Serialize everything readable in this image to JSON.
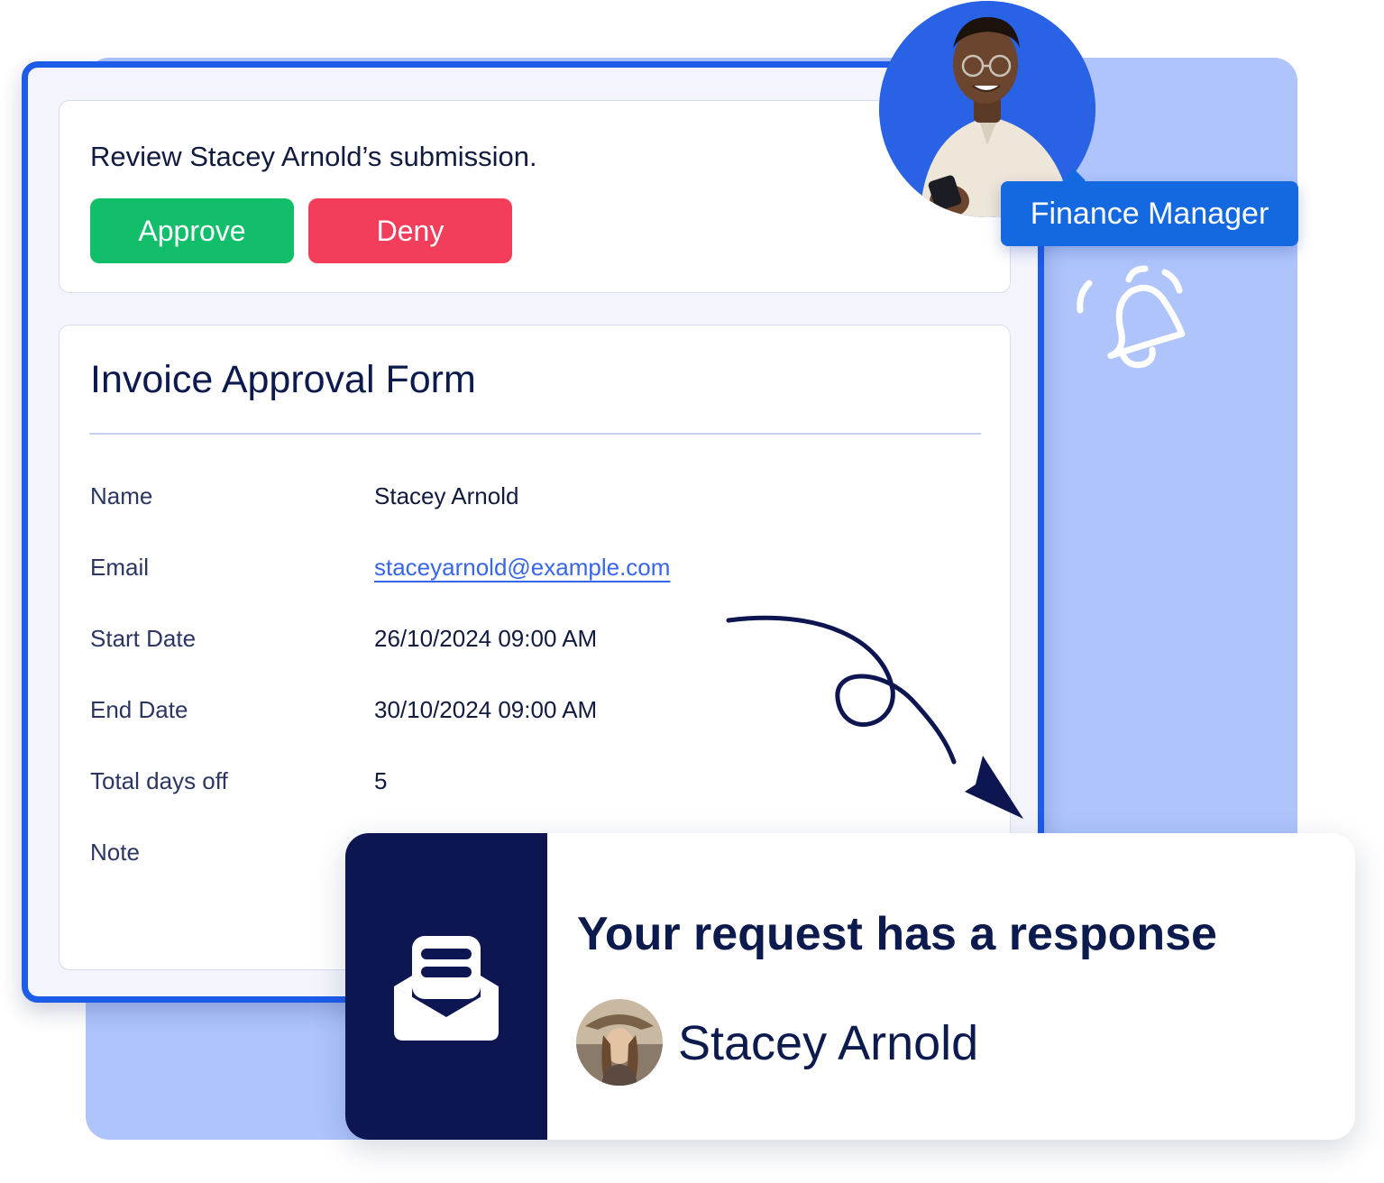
{
  "review": {
    "prompt": "Review Stacey Arnold’s submission.",
    "approve_label": "Approve",
    "deny_label": "Deny"
  },
  "form": {
    "title": "Invoice Approval Form",
    "fields": [
      {
        "label": "Name",
        "value": "Stacey Arnold"
      },
      {
        "label": "Email",
        "value": "staceyarnold@example.com"
      },
      {
        "label": "Start Date",
        "value": "26/10/2024 09:00 AM"
      },
      {
        "label": "End Date",
        "value": "30/10/2024 09:00 AM"
      },
      {
        "label": "Total days off",
        "value": "5"
      },
      {
        "label": "Note",
        "value": ""
      }
    ]
  },
  "approver": {
    "role": "Finance Manager",
    "avatar_icon": "man-avatar-photo",
    "notification_icon": "bell-icon"
  },
  "notification": {
    "icon": "open-mail-icon",
    "title": "Your request has a response",
    "user_name": "Stacey Arnold",
    "user_avatar": "woman-avatar-photo"
  },
  "colors": {
    "brand_blue": "#1c5ce8",
    "panel_blue": "#aec4fb",
    "approve_green": "#13be6b",
    "deny_red": "#f33e5b",
    "navy": "#0d1650",
    "link_blue": "#3866e8"
  }
}
